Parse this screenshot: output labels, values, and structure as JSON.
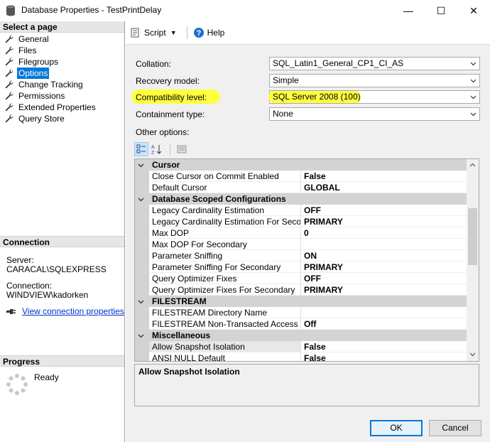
{
  "window": {
    "title": "Database Properties - TestPrintDelay",
    "minimize": "—",
    "maximize": "☐",
    "close": "✕"
  },
  "left": {
    "select_page_header": "Select a page",
    "pages": [
      {
        "label": "General",
        "selected": false
      },
      {
        "label": "Files",
        "selected": false
      },
      {
        "label": "Filegroups",
        "selected": false
      },
      {
        "label": "Options",
        "selected": true
      },
      {
        "label": "Change Tracking",
        "selected": false
      },
      {
        "label": "Permissions",
        "selected": false
      },
      {
        "label": "Extended Properties",
        "selected": false
      },
      {
        "label": "Query Store",
        "selected": false
      }
    ],
    "connection_header": "Connection",
    "server_label": "Server:",
    "server_value": "CARACAL\\SQLEXPRESS",
    "connection_label": "Connection:",
    "connection_value": "WINDVIEW\\kadorken",
    "view_connection_link": "View connection properties",
    "progress_header": "Progress",
    "progress_status": "Ready"
  },
  "toolbar": {
    "script_label": "Script",
    "help_label": "Help"
  },
  "options": {
    "collation_label": "Collation:",
    "collation_value": "SQL_Latin1_General_CP1_CI_AS",
    "recovery_label": "Recovery model:",
    "recovery_value": "Simple",
    "compat_label": "Compatibility level:",
    "compat_value": "SQL Server 2008 (100)",
    "containment_label": "Containment type:",
    "containment_value": "None",
    "other_options_label": "Other options:"
  },
  "grid": {
    "rows": [
      {
        "type": "cat",
        "name": "Cursor"
      },
      {
        "type": "prop",
        "name": "Close Cursor on Commit Enabled",
        "value": "False"
      },
      {
        "type": "prop",
        "name": "Default Cursor",
        "value": "GLOBAL"
      },
      {
        "type": "cat",
        "name": "Database Scoped Configurations"
      },
      {
        "type": "prop",
        "name": "Legacy Cardinality Estimation",
        "value": "OFF"
      },
      {
        "type": "prop",
        "name": "Legacy Cardinality Estimation For Secondary",
        "value": "PRIMARY"
      },
      {
        "type": "prop",
        "name": "Max DOP",
        "value": "0"
      },
      {
        "type": "prop",
        "name": "Max DOP For Secondary",
        "value": ""
      },
      {
        "type": "prop",
        "name": "Parameter Sniffing",
        "value": "ON"
      },
      {
        "type": "prop",
        "name": "Parameter Sniffing For Secondary",
        "value": "PRIMARY"
      },
      {
        "type": "prop",
        "name": "Query Optimizer Fixes",
        "value": "OFF"
      },
      {
        "type": "prop",
        "name": "Query Optimizer Fixes For Secondary",
        "value": "PRIMARY"
      },
      {
        "type": "cat",
        "name": "FILESTREAM"
      },
      {
        "type": "prop",
        "name": "FILESTREAM Directory Name",
        "value": ""
      },
      {
        "type": "prop",
        "name": "FILESTREAM Non-Transacted Access",
        "value": "Off"
      },
      {
        "type": "cat",
        "name": "Miscellaneous"
      },
      {
        "type": "prop",
        "name": "Allow Snapshot Isolation",
        "value": "False",
        "selected": true
      },
      {
        "type": "prop",
        "name": "ANSI NULL Default",
        "value": "False"
      }
    ],
    "description_title": "Allow Snapshot Isolation"
  },
  "footer": {
    "ok_label": "OK",
    "cancel_label": "Cancel"
  },
  "colors": {
    "selection": "#0078d7",
    "highlight": "#ffff40",
    "link": "#0033cc"
  }
}
